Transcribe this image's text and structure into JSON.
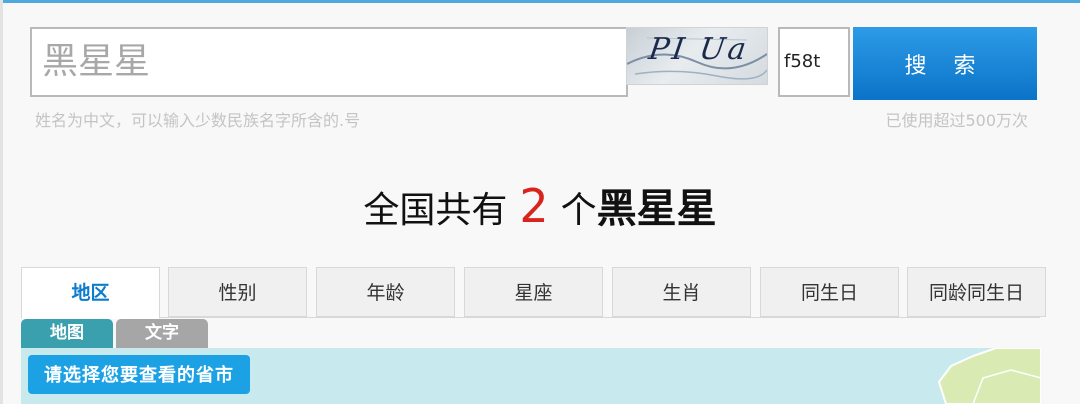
{
  "search": {
    "value": "黑星星",
    "hint_left": "姓名为中文，可以输入少数民族名字所含的.号",
    "hint_right": "已使用超过500万次"
  },
  "captcha": {
    "image_text": "PI Ua"
  },
  "code_input": {
    "value": "f58t"
  },
  "search_button": {
    "label": "搜 索"
  },
  "result": {
    "prefix": "全国共有",
    "count": "2",
    "unit": "个",
    "name": "黑星星"
  },
  "tabs": [
    {
      "label": "地区",
      "active": true
    },
    {
      "label": "性别"
    },
    {
      "label": "年龄"
    },
    {
      "label": "星座"
    },
    {
      "label": "生肖"
    },
    {
      "label": "同生日"
    },
    {
      "label": "同龄同生日"
    }
  ],
  "subtabs": [
    {
      "label": "地图",
      "color": "#3aa0ad"
    },
    {
      "label": "文字",
      "color": "#a6a6a6"
    }
  ],
  "map": {
    "prompt": "请选择您要查看的省市"
  },
  "colors": {
    "accent_blue": "#1a8ad8",
    "count_red": "#d8241c",
    "map_bg": "#c8e9ee"
  }
}
